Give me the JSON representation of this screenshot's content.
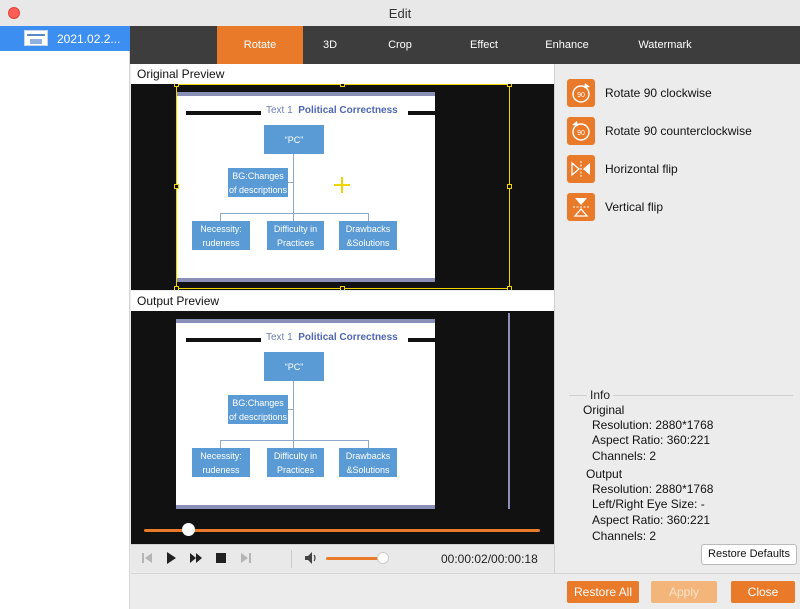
{
  "window": {
    "title": "Edit"
  },
  "sidebar": {
    "file_name": "2021.02.2..."
  },
  "tabs": [
    {
      "label": "Rotate",
      "active": true
    },
    {
      "label": "3D",
      "active": false
    },
    {
      "label": "Crop",
      "active": false
    },
    {
      "label": "Effect",
      "active": false
    },
    {
      "label": "Enhance",
      "active": false
    },
    {
      "label": "Watermark",
      "active": false
    }
  ],
  "preview": {
    "original_label": "Original Preview",
    "output_label": "Output Preview",
    "slide": {
      "head_prefix": "Text 1",
      "head_title": "Political Correctness",
      "top_box": "“PC”",
      "mid_box": "BG:Changes of descriptions",
      "box1": "Necessity: rudeness",
      "box2": "Difficulty in Practices",
      "box3": "Drawbacks &Solutions"
    }
  },
  "player": {
    "time": "00:00:02/00:00:18",
    "progress_percent": 11,
    "volume_percent": 95
  },
  "rotate_actions": [
    {
      "label": "Rotate 90 clockwise",
      "icon": "rotate-cw-90-icon"
    },
    {
      "label": "Rotate 90 counterclockwise",
      "icon": "rotate-ccw-90-icon"
    },
    {
      "label": "Horizontal flip",
      "icon": "horizontal-flip-icon"
    },
    {
      "label": "Vertical flip",
      "icon": "vertical-flip-icon"
    }
  ],
  "info": {
    "title": "Info",
    "original_heading": "Original",
    "original_resolution": "Resolution: 2880*1768",
    "original_aspect": "Aspect Ratio: 360:221",
    "original_channels": "Channels: 2",
    "output_heading": "Output",
    "output_resolution": "Resolution: 2880*1768",
    "output_eye_size": "Left/Right Eye Size: -",
    "output_aspect": "Aspect Ratio: 360:221",
    "output_channels": "Channels: 2"
  },
  "buttons": {
    "restore_defaults": "Restore Defaults",
    "restore_all": "Restore All",
    "apply": "Apply",
    "close": "Close"
  },
  "colors": {
    "accent": "#e97a2a",
    "selection": "#3c8ef0",
    "crop_frame": "#f0d400"
  }
}
